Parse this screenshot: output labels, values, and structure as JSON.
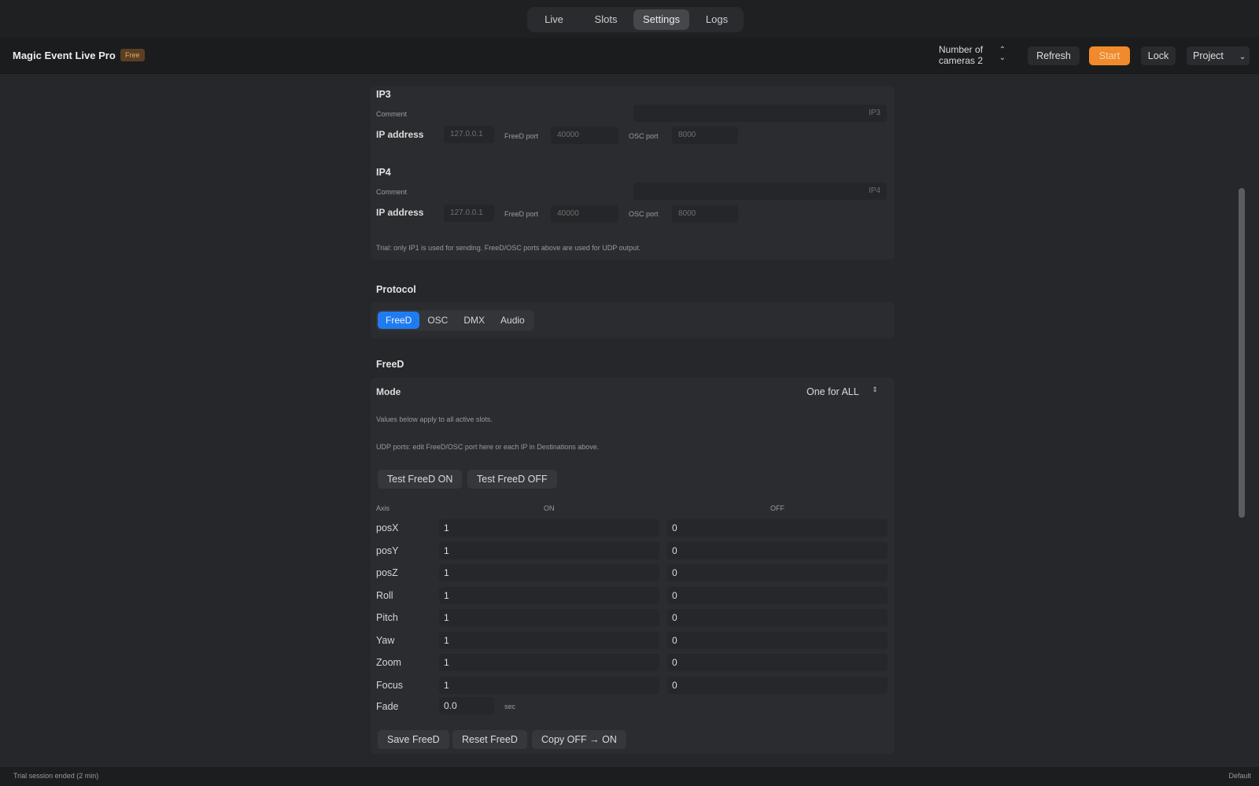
{
  "nav": {
    "tabs": [
      {
        "label": "Live",
        "active": false
      },
      {
        "label": "Slots",
        "active": false
      },
      {
        "label": "Settings",
        "active": true
      },
      {
        "label": "Logs",
        "active": false
      }
    ]
  },
  "header": {
    "app_title": "Magic Event Live Pro",
    "plan_badge": "Free",
    "cameras_label": "Number of cameras 2",
    "refresh": "Refresh",
    "start": "Start",
    "lock": "Lock",
    "project": "Project"
  },
  "destinations": {
    "ip3": {
      "title": "IP3",
      "comment_label": "Comment",
      "comment_placeholder": "IP3",
      "ip_label": "IP address",
      "ip_value": "127.0.0.1",
      "freed_port_label": "FreeD port",
      "freed_port_value": "40000",
      "osc_port_label": "OSC port",
      "osc_port_value": "8000"
    },
    "ip4": {
      "title": "IP4",
      "comment_label": "Comment",
      "comment_placeholder": "IP4",
      "ip_label": "IP address",
      "ip_value": "127.0.0.1",
      "freed_port_label": "FreeD port",
      "freed_port_value": "40000",
      "osc_port_label": "OSC port",
      "osc_port_value": "8000"
    },
    "trial_note": "Trial: only IP1 is used for sending. FreeD/OSC ports above are used for UDP output."
  },
  "protocol": {
    "title": "Protocol",
    "options": [
      {
        "label": "FreeD",
        "active": true
      },
      {
        "label": "OSC",
        "active": false
      },
      {
        "label": "DMX",
        "active": false
      },
      {
        "label": "Audio",
        "active": false
      }
    ]
  },
  "freed": {
    "title": "FreeD",
    "mode_label": "Mode",
    "mode_value": "One for ALL",
    "note1": "Values below apply to all active slots.",
    "note2": "UDP ports: edit FreeD/OSC port here or each IP in Destinations above.",
    "test_on": "Test FreeD ON",
    "test_off": "Test FreeD OFF",
    "col_axis": "Axis",
    "col_on": "ON",
    "col_off": "OFF",
    "rows": [
      {
        "axis": "posX",
        "on": "1",
        "off": "0"
      },
      {
        "axis": "posY",
        "on": "1",
        "off": "0"
      },
      {
        "axis": "posZ",
        "on": "1",
        "off": "0"
      },
      {
        "axis": "Roll",
        "on": "1",
        "off": "0"
      },
      {
        "axis": "Pitch",
        "on": "1",
        "off": "0"
      },
      {
        "axis": "Yaw",
        "on": "1",
        "off": "0"
      },
      {
        "axis": "Zoom",
        "on": "1",
        "off": "0"
      },
      {
        "axis": "Focus",
        "on": "1",
        "off": "0"
      }
    ],
    "fade_label": "Fade",
    "fade_value": "0.0",
    "fade_unit": "sec",
    "save": "Save FreeD",
    "reset": "Reset FreeD",
    "copy": "Copy OFF → ON"
  },
  "footer": {
    "status": "Trial session ended (2 min)",
    "profile": "Default"
  }
}
